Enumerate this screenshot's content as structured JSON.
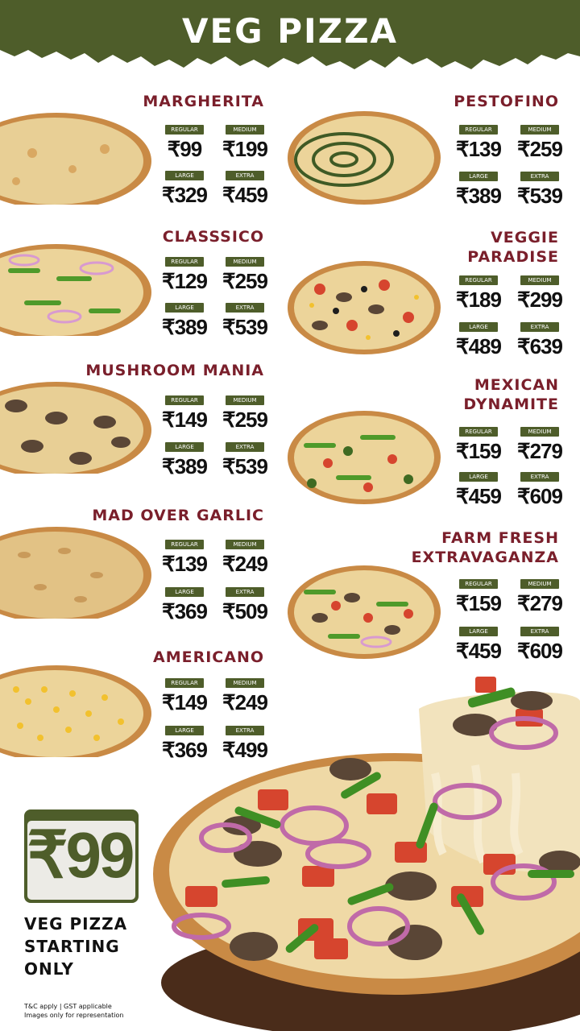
{
  "header": {
    "title": "VEG PIZZA"
  },
  "size_labels": [
    "REGULAR",
    "MEDIUM",
    "LARGE",
    "EXTRA LARGE"
  ],
  "pizzas": [
    {
      "name": "MARGHERITA",
      "prices": [
        "₹99",
        "₹199",
        "₹329",
        "₹459"
      ]
    },
    {
      "name": "PESTOFINO",
      "prices": [
        "₹139",
        "₹259",
        "₹389",
        "₹539"
      ]
    },
    {
      "name": "CLASSSICO",
      "prices": [
        "₹129",
        "₹259",
        "₹389",
        "₹539"
      ]
    },
    {
      "name": "VEGGIE PARADISE",
      "prices": [
        "₹189",
        "₹299",
        "₹489",
        "₹639"
      ]
    },
    {
      "name": "MUSHROOM MANIA",
      "prices": [
        "₹149",
        "₹259",
        "₹389",
        "₹539"
      ]
    },
    {
      "name": "MEXICAN DYNAMITE",
      "prices": [
        "₹159",
        "₹279",
        "₹459",
        "₹609"
      ]
    },
    {
      "name": "MAD OVER GARLIC",
      "prices": [
        "₹139",
        "₹249",
        "₹369",
        "₹509"
      ]
    },
    {
      "name": "FARM FRESH EXTRAVAGANZA",
      "prices": [
        "₹159",
        "₹279",
        "₹459",
        "₹609"
      ]
    },
    {
      "name": "AMERICANO",
      "prices": [
        "₹149",
        "₹249",
        "₹369",
        "₹499"
      ]
    }
  ],
  "promo": {
    "price": "₹99",
    "line1": "VEG PIZZA",
    "line2": "STARTING",
    "line3": "ONLY",
    "fine1": "T&C apply | GST applicable",
    "fine2": "Images only for representation"
  },
  "colors": {
    "brand_green": "#4e5d2a",
    "name_maroon": "#7a1f2b",
    "crust": "#c98a45",
    "cheese": "#e8cf95"
  }
}
